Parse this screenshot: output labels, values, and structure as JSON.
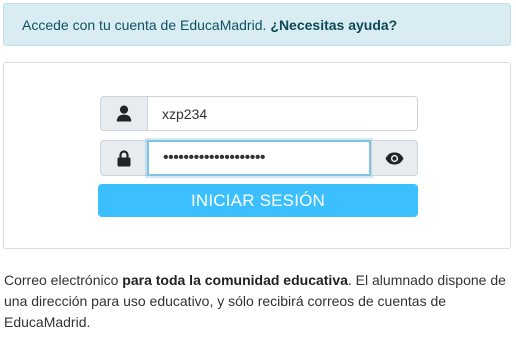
{
  "info_banner": {
    "text": "Accede con tu cuenta de EducaMadrid.",
    "help_link": "¿Necesitas ayuda?",
    "background": "#d9ecf2",
    "text_color": "#0c5460"
  },
  "login_form": {
    "username_icon": "user-icon",
    "username_value": "xzp234",
    "password_icon": "lock-icon",
    "password_value": "••••••••••••••••••••",
    "toggle_visibility_icon": "eye-icon",
    "submit_label": "INICIAR SESIÓN",
    "submit_color": "#3bbfff"
  },
  "description": {
    "part1": "Correo electrónico",
    "bold": "para toda la comunidad educativa",
    "part2": ". El alumnado dispone de una dirección para uso educativo, y sólo recibirá correos de cuentas de EducaMadrid."
  }
}
